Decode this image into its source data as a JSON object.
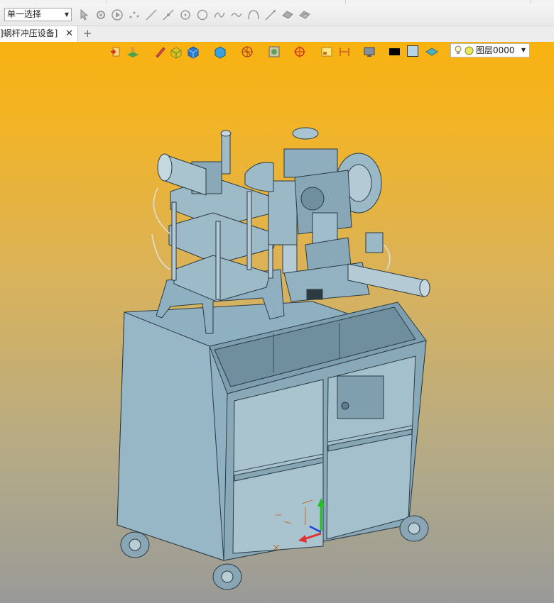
{
  "toolbar": {
    "selection_filter": "单一选择",
    "tools": [
      "pick-icon",
      "pick-filter-icon",
      "play-icon",
      "point-icon",
      "line-icon",
      "line2-icon",
      "circle-center-icon",
      "circle-icon",
      "spline-icon",
      "curve-icon",
      "arc-icon",
      "line3-icon",
      "shape1-icon",
      "shape2-icon"
    ]
  },
  "tabs": {
    "document": "]蜗杆冲压设备]",
    "close_symbol": "✕",
    "add_symbol": "+"
  },
  "view_toolbar": {
    "layer_name": "图层0000",
    "icons": [
      "exit-sketch-icon",
      "layer-tree-icon",
      "pencil-icon",
      "solid-icon",
      "cube-shade-icon",
      "cube-blue-icon",
      "sphere-wire-icon",
      "render-icon",
      "target-icon",
      "window-icon",
      "section-icon",
      "monitor-icon",
      "color-swatch-icon",
      "face-color-icon",
      "plane-icon",
      "bulb-icon",
      "sun-icon"
    ],
    "colors": {
      "line_swatch": "#000000",
      "face_swatch": "#b7d4e8"
    }
  },
  "scene": {
    "model_color": "#8fb0c0",
    "model_dark": "#6f8f9f",
    "axis_colors": {
      "x": "#e03030",
      "y": "#22c022",
      "z": "#2040e0"
    }
  }
}
